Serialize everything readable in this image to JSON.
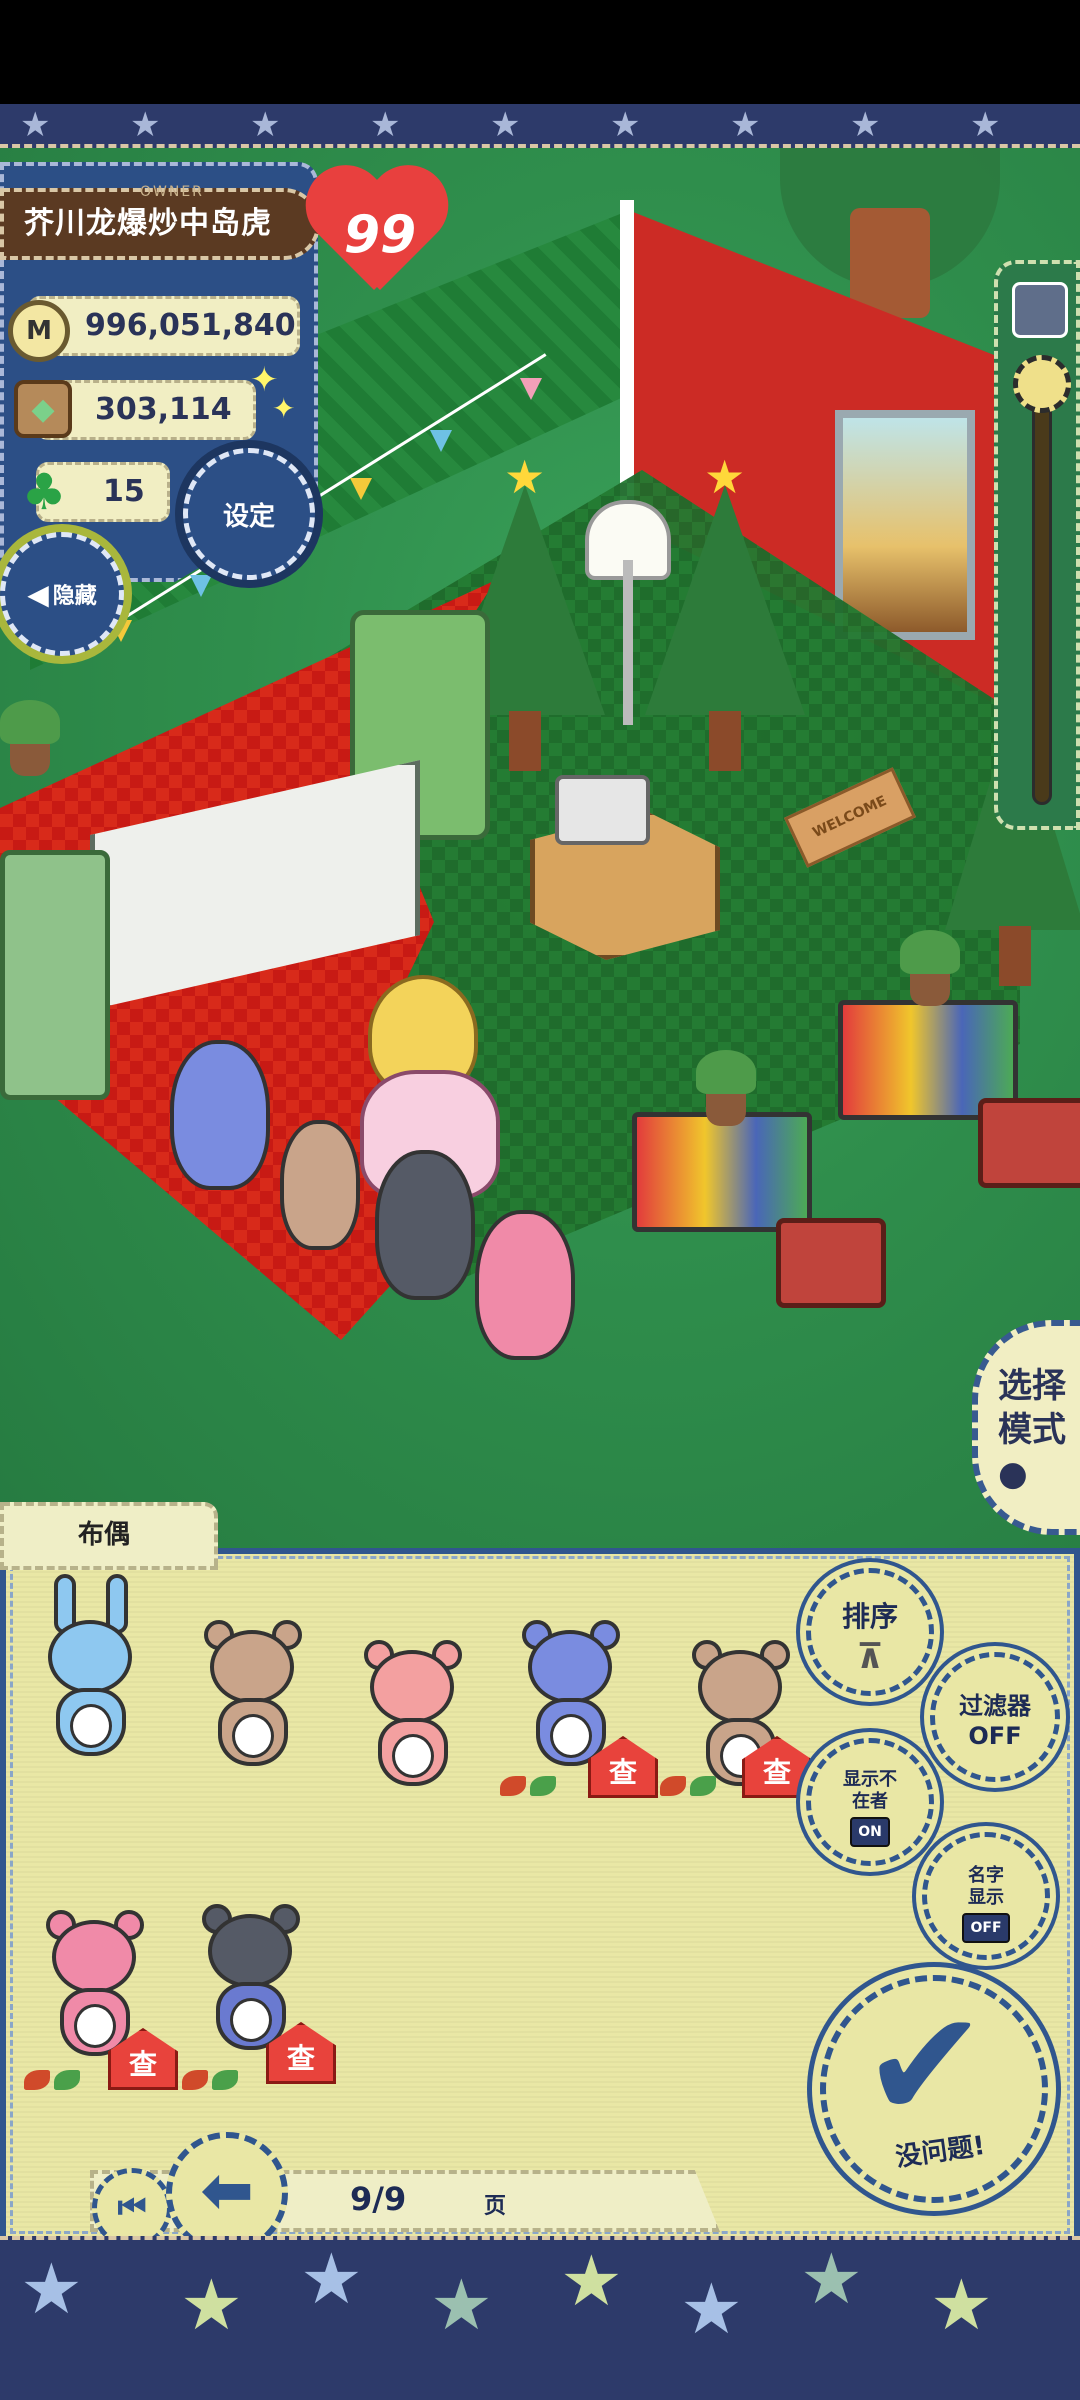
{
  "owner": {
    "tag": "OWNER",
    "name": "芥川龙爆炒中岛虎",
    "level": "99"
  },
  "stats": {
    "money": "996,051,840",
    "money_icon": "M",
    "food": "303,114",
    "clover": "15"
  },
  "buttons": {
    "settings": "设定",
    "hide": "隐藏",
    "select_mode": "选择模式",
    "sort": "排序",
    "filter": "过滤器OFF",
    "show_absent": "显示不在者",
    "show_absent_toggle": "ON",
    "show_name": "名字显示",
    "show_name_toggle": "OFF",
    "ok": "没问题!"
  },
  "panel": {
    "tab_label": "布偶",
    "house_tag_char": "查"
  },
  "pager": {
    "page_label": "9/9",
    "page_suffix": "页"
  },
  "scene": {
    "mat_text": "WELCOME"
  },
  "icons": [
    "m-coin-icon",
    "food-basket-icon",
    "clover-icon",
    "sparkle-icon",
    "arrow-left-icon",
    "zoom-cube-icon",
    "mouse-icon",
    "claw-icon",
    "check-icon",
    "first-page-icon",
    "prev-page-icon",
    "house-icon"
  ],
  "colors": {
    "panel_bg": "#e9e7a5",
    "panel_border": "#30568e",
    "owner_panel": "#2c4f86",
    "heart": "#e8403e",
    "star_strip": "#2d3a6a"
  }
}
